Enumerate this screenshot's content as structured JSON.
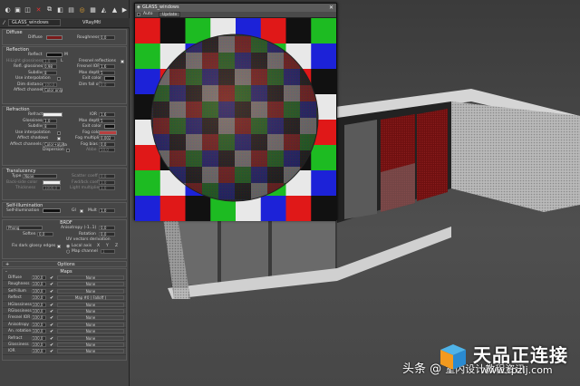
{
  "toolbar": {
    "material_name": "GLASS_windows",
    "material_type": "VRayMtl"
  },
  "diffuse": {
    "title": "Diffuse",
    "diffuse_label": "Diffuse",
    "roughness_label": "Roughness",
    "roughness_value": "0,0",
    "diffuse_color": "#7a1a1a"
  },
  "reflection": {
    "title": "Reflection",
    "reflect_label": "Reflect",
    "m_label": "M",
    "hilight_label": "HiLight glossiness",
    "hilight_value": "1,0",
    "l_label": "L",
    "fresnel_label": "Fresnel reflections",
    "refl_gloss_label": "Refl. glossiness",
    "refl_gloss_value": "0,98",
    "fresnel_ior_label": "Fresnel IOR",
    "fresnel_ior_value": "1,6",
    "subdivs_label": "Subdivs",
    "subdivs_value": "8",
    "max_depth_label": "Max depth",
    "max_depth_value": "5",
    "use_interp_label": "Use interpolation",
    "exit_color_label": "Exit color",
    "dim_distance_label": "Dim distance",
    "dim_distance_value": "100,0",
    "dim_falloff_label": "Dim fall off",
    "dim_falloff_value": "0,0",
    "affect_channels_label": "Affect channels",
    "affect_channels_value": "Color only"
  },
  "refraction": {
    "title": "Refraction",
    "refract_label": "Refract",
    "ior_label": "IOR",
    "ior_value": "1,6",
    "glossiness_label": "Glossiness",
    "glossiness_value": "1,0",
    "max_depth_label": "Max depth",
    "max_depth_value": "5",
    "subdivs_label": "Subdivs",
    "subdivs_value": "8",
    "exit_color_label": "Exit color",
    "use_interp_label": "Use interpolation",
    "fog_color_label": "Fog color",
    "fog_color": "#b84040",
    "affect_shadows_label": "Affect shadows",
    "fog_mult_label": "Fog multiplier",
    "fog_mult_value": "0,002",
    "affect_channels_label": "Affect channels",
    "affect_channels_value": "Color+alpha",
    "fog_bias_label": "Fog bias",
    "fog_bias_value": "0,0",
    "dispersion_label": "Dispersion",
    "abbe_label": "Abbe",
    "abbe_value": "50,0"
  },
  "translucency": {
    "title": "Translucency",
    "type_label": "Type",
    "type_value": "None",
    "scatter_label": "Scatter coeff",
    "scatter_value": "0,0",
    "back_color_label": "Back-side color",
    "fwd_bck_label": "Fwd/bck coeff",
    "fwd_bck_value": "1,0",
    "thickness_label": "Thickness",
    "thickness_value": "1000,0",
    "light_mult_label": "Light multiplier",
    "light_mult_value": "1,0"
  },
  "self_illum": {
    "title": "Self-illumination",
    "label": "Self-illumination",
    "gi_label": "GI",
    "mult_label": "Mult",
    "mult_value": "1,0"
  },
  "brdf": {
    "title": "BRDF",
    "type_value": "Phong",
    "anisotropy_label": "Anisotropy (-1..1)",
    "anisotropy_value": "0,0",
    "soften_label": "Soften",
    "soften_value": "0,0",
    "rotation_label": "Rotation",
    "rotation_value": "0,0",
    "uv_label": "UV vectors derivation",
    "fix_dark_label": "Fix dark glossy edges",
    "local_axis_label": "Local axis",
    "x_label": "X",
    "y_label": "Y",
    "z_label": "Z",
    "map_channel_label": "Map channel",
    "map_channel_value": "1"
  },
  "options": {
    "title": "Options"
  },
  "maps": {
    "title": "Maps",
    "rows": [
      {
        "name": "Diffuse",
        "value": "100,0",
        "map": "None"
      },
      {
        "name": "Roughness",
        "value": "100,0",
        "map": "None"
      },
      {
        "name": "Self-illum",
        "value": "100,0",
        "map": "None"
      },
      {
        "name": "Reflect",
        "value": "100,0",
        "map": "Map #0 ( Falloff )"
      },
      {
        "name": "HGlossiness",
        "value": "100,0",
        "map": "None"
      },
      {
        "name": "RGlossiness",
        "value": "100,0",
        "map": "None"
      },
      {
        "name": "Fresnel IOR",
        "value": "100,0",
        "map": "None"
      },
      {
        "name": "Anisotropy",
        "value": "100,0",
        "map": "None"
      },
      {
        "name": "An. rotation",
        "value": "100,0",
        "map": "None"
      },
      {
        "name": "Refract",
        "value": "100,0",
        "map": "None"
      },
      {
        "name": "Glossiness",
        "value": "100,0",
        "map": "None"
      },
      {
        "name": "IOR",
        "value": "100,0",
        "map": "None"
      }
    ]
  },
  "preview_window": {
    "title": "GLASS_windows",
    "auto_label": "Auto",
    "update_label": "Update"
  },
  "watermark": {
    "platform": "头条",
    "at": "@",
    "author": "室内设计教程资讯",
    "brand": "天品正连接",
    "url": "www.tpzlj.com"
  }
}
